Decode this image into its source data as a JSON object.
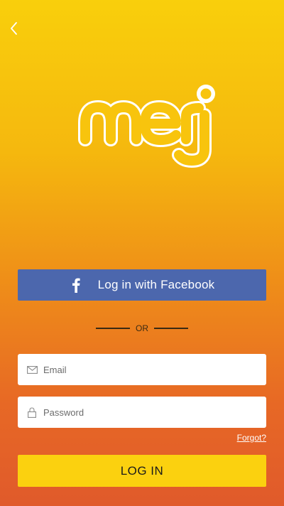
{
  "colors": {
    "gradient_top": "#f9cf0c",
    "gradient_bottom": "#e05a2b",
    "facebook_blue": "#4c67ad",
    "login_yellow": "#fbd10f"
  },
  "header": {
    "back_icon": "chevron-left-icon"
  },
  "logo": {
    "text": "merj",
    "icon": "merj-logo"
  },
  "facebook": {
    "label": "Log in with Facebook",
    "icon": "facebook-icon"
  },
  "divider": {
    "label": "OR"
  },
  "form": {
    "email": {
      "placeholder": "Email",
      "value": "",
      "icon": "envelope-icon"
    },
    "password": {
      "placeholder": "Password",
      "value": "",
      "icon": "lock-icon"
    },
    "forgot_label": "Forgot?",
    "login_label": "LOG IN"
  }
}
